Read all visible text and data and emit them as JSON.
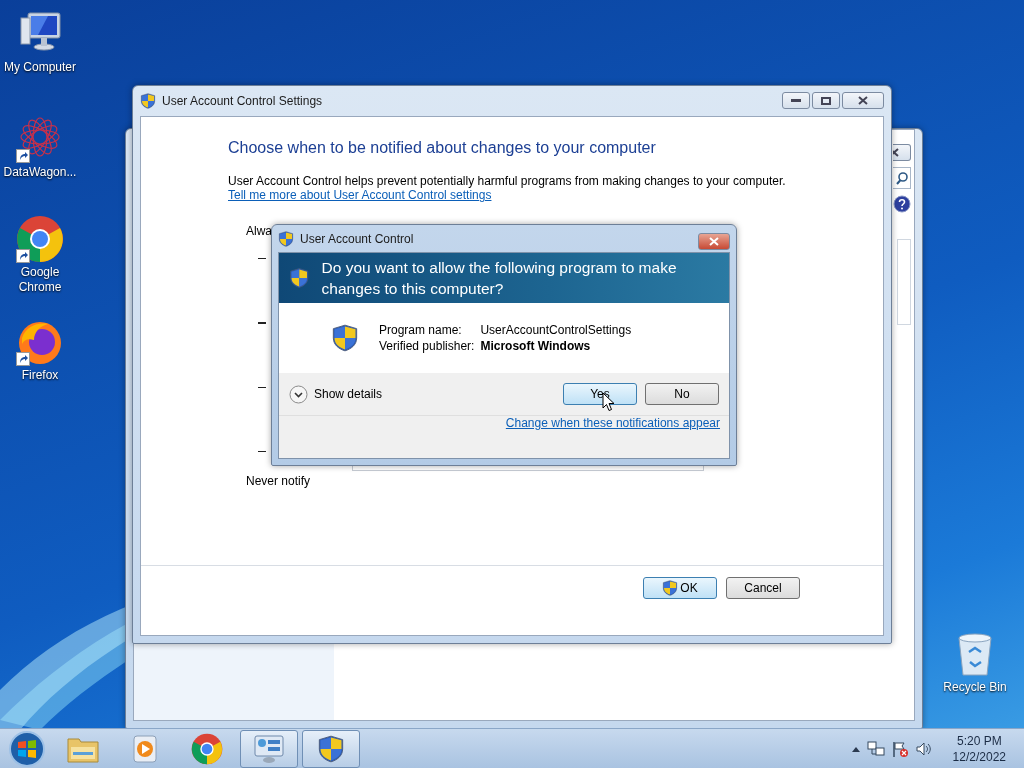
{
  "desktop_icons": [
    {
      "label": "My Computer",
      "kind": "computer",
      "shortcut": false
    },
    {
      "label": "DataWagon...",
      "kind": "datawagon",
      "shortcut": true
    },
    {
      "label": "Google Chrome",
      "kind": "chrome",
      "shortcut": true
    },
    {
      "label": "Firefox",
      "kind": "firefox",
      "shortcut": true
    },
    {
      "label": "Recycle Bin",
      "kind": "bin",
      "shortcut": false
    }
  ],
  "settings_window": {
    "title": "User Account Control Settings",
    "heading": "Choose when to be notified about changes to your computer",
    "description": "User Account Control helps prevent potentially harmful programs from making changes to your computer.",
    "link": "Tell me more about User Account Control settings",
    "top_label": "Alwa",
    "bottom_label": "Never notify",
    "buttons": [
      {
        "label": "OK",
        "kind": "shield"
      },
      {
        "label": "Cancel",
        "kind": "plain"
      }
    ]
  },
  "uac_dialog": {
    "title": "User Account Control",
    "question": "Do you want to allow the following program to make changes to this computer?",
    "fields": [
      {
        "label": "Program name:",
        "value": "UserAccountControlSettings",
        "bold": false
      },
      {
        "label": "Verified publisher:",
        "value": "Microsoft Windows",
        "bold": true
      }
    ],
    "details_toggle": {
      "label": "Show details",
      "expanded": false
    },
    "buttons": [
      {
        "label": "Yes",
        "focused": true
      },
      {
        "label": "No",
        "focused": false
      }
    ],
    "link": "Change when these notifications appear"
  },
  "taskbar": {
    "items": [
      {
        "kind": "explorer",
        "active": false
      },
      {
        "kind": "media",
        "active": false
      },
      {
        "kind": "chrome",
        "active": false
      },
      {
        "kind": "control-panel",
        "active": true
      },
      {
        "kind": "shield",
        "active": true
      }
    ],
    "clock": {
      "time": "5:20 PM",
      "date": "12/2/2022"
    }
  }
}
